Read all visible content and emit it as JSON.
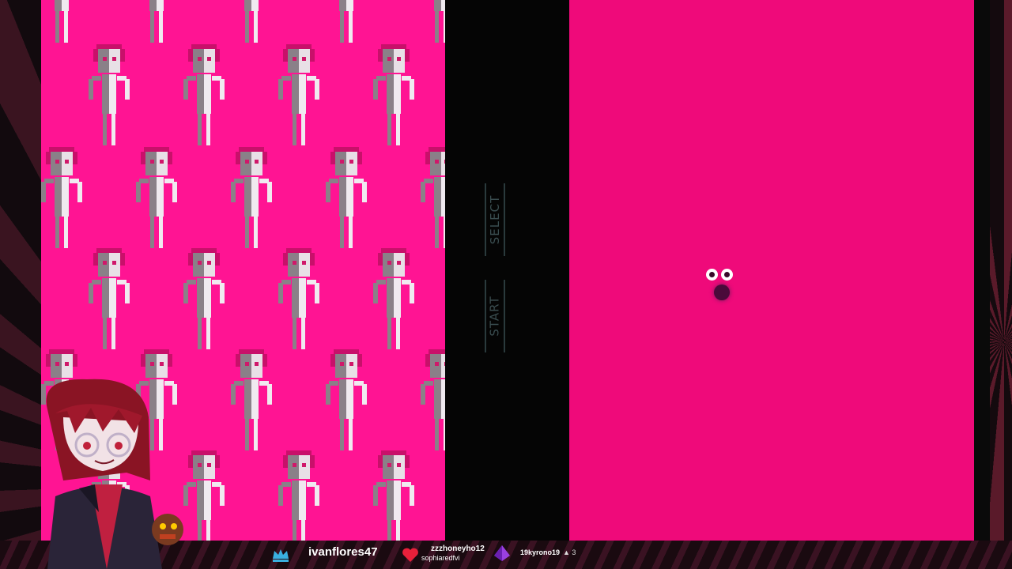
{
  "console": {
    "select_label": "SELECT",
    "start_label": "START"
  },
  "stream_bar": {
    "latest_sub": "ivanflores47",
    "latest_follower": "zzzhoneyho12",
    "latest_follower_sub": "sophiaredfvi",
    "top_cheer": "19kyrono19",
    "top_cheer_count": "▲ 3"
  },
  "colors": {
    "left_screen": "#ff1493",
    "right_screen": "#ef0a7a"
  },
  "icons": [
    "crown-icon",
    "heart-icon",
    "gem-icon"
  ]
}
